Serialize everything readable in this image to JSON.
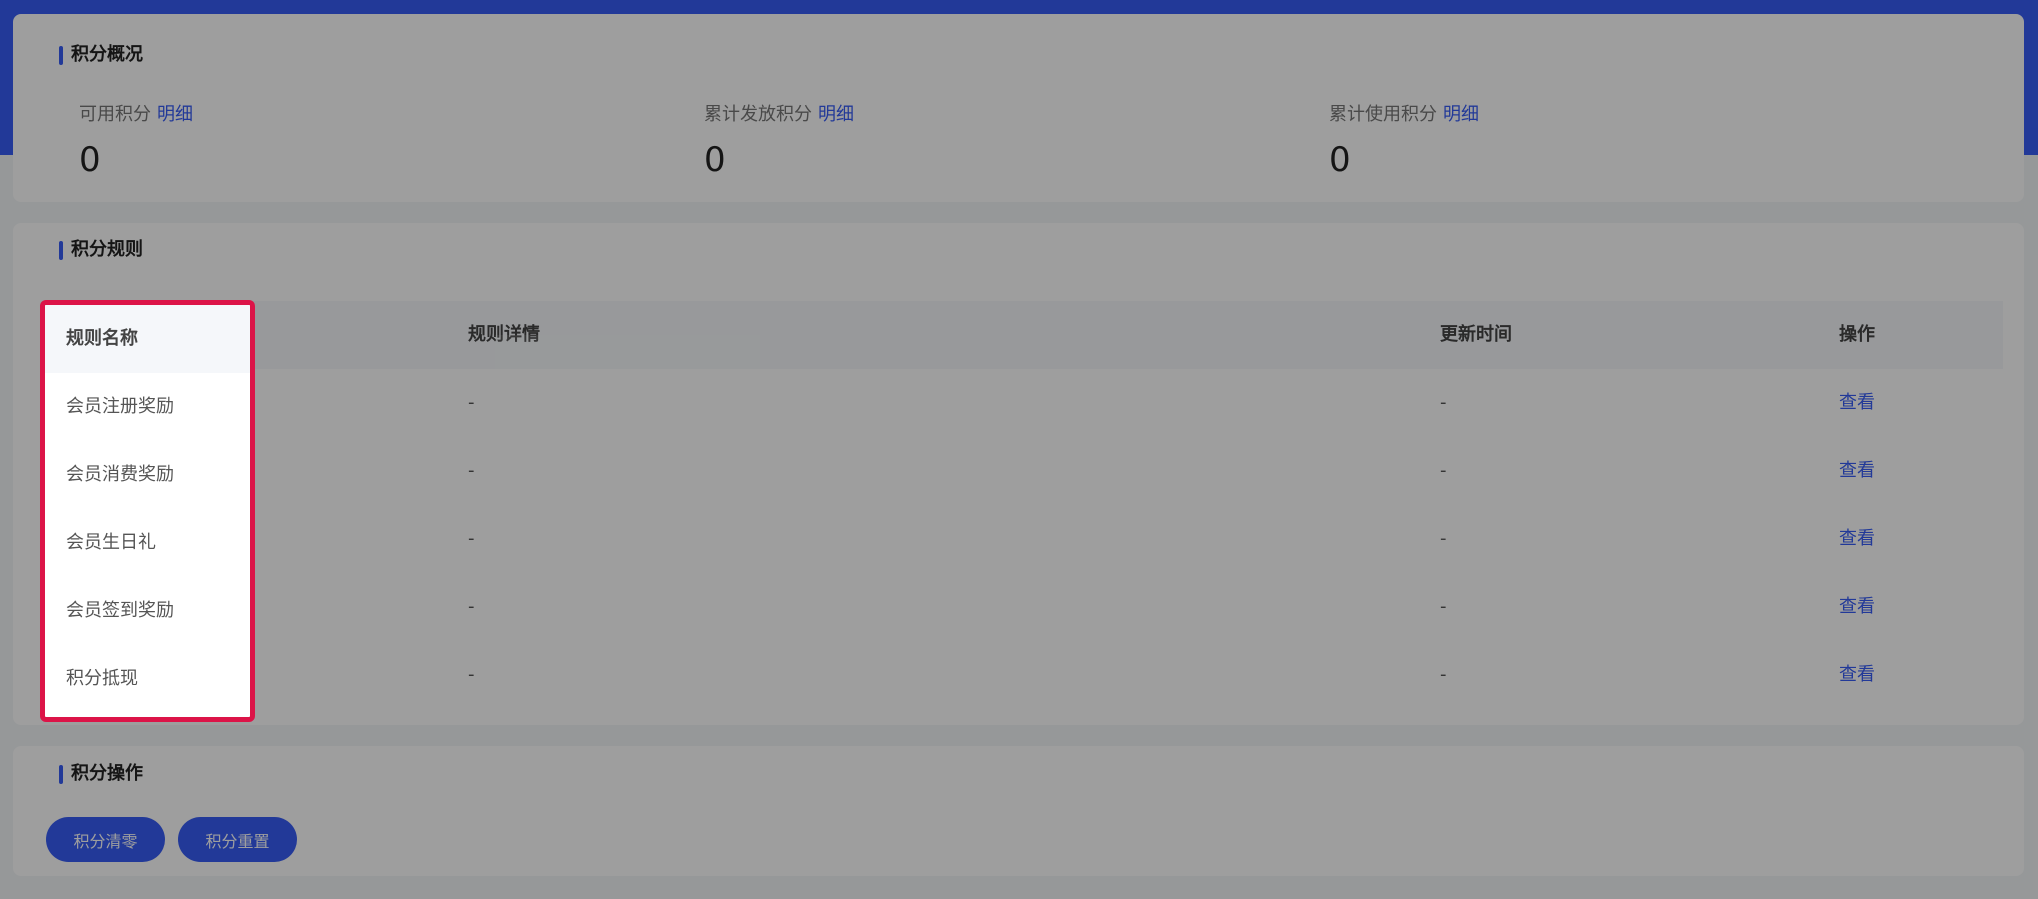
{
  "overview": {
    "title": "积分概况",
    "stats": [
      {
        "label": "可用积分",
        "link": "明细",
        "value": "0"
      },
      {
        "label": "累计发放积分",
        "link": "明细",
        "value": "0"
      },
      {
        "label": "累计使用积分",
        "link": "明细",
        "value": "0"
      }
    ]
  },
  "rules": {
    "title": "积分规则",
    "columns": [
      "规则名称",
      "规则详情",
      "更新时间",
      "操作"
    ],
    "rows": [
      {
        "name": "会员注册奖励",
        "detail": "-",
        "time": "-",
        "action": "查看"
      },
      {
        "name": "会员消费奖励",
        "detail": "-",
        "time": "-",
        "action": "查看"
      },
      {
        "name": "会员生日礼",
        "detail": "-",
        "time": "-",
        "action": "查看"
      },
      {
        "name": "会员签到奖励",
        "detail": "-",
        "time": "-",
        "action": "查看"
      },
      {
        "name": "积分抵现",
        "detail": "-",
        "time": "-",
        "action": "查看"
      }
    ]
  },
  "operations": {
    "title": "积分操作",
    "buttons": [
      "积分清零",
      "积分重置"
    ]
  },
  "watermark": {
    "title": "倍效店务",
    "subtitle": "数字化门店经营整体解决方案"
  },
  "colors": {
    "accent": "#375df5",
    "highlight": "#dc1448"
  }
}
